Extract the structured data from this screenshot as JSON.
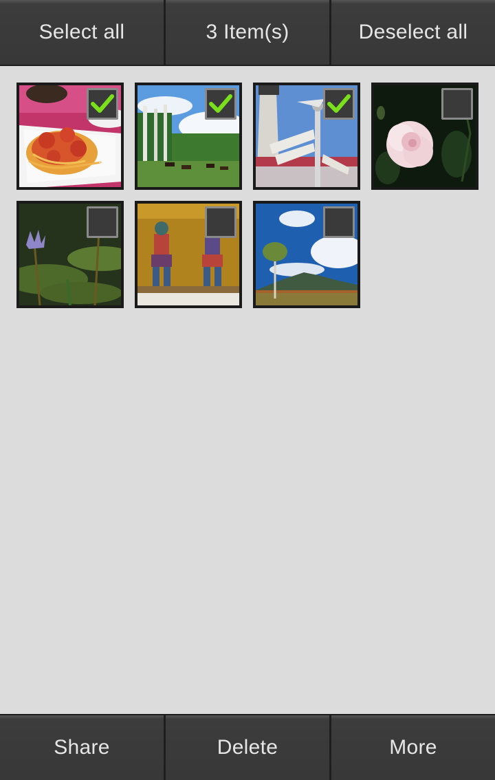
{
  "top_bar": {
    "select_all": "Select all",
    "item_count": "3 Item(s)",
    "deselect_all": "Deselect all"
  },
  "bottom_bar": {
    "share": "Share",
    "delete": "Delete",
    "more": "More"
  },
  "photos": [
    {
      "name": "spaghetti",
      "selected": true
    },
    {
      "name": "horses-meadow",
      "selected": true
    },
    {
      "name": "lighthouse-sign",
      "selected": true
    },
    {
      "name": "pink-rose",
      "selected": false
    },
    {
      "name": "water-lily",
      "selected": false
    },
    {
      "name": "temple-statues",
      "selected": false
    },
    {
      "name": "mountain-tree",
      "selected": false
    }
  ],
  "colors": {
    "check_green": "#7be01c",
    "background": "#dcdcdc",
    "bar": "#383838"
  }
}
